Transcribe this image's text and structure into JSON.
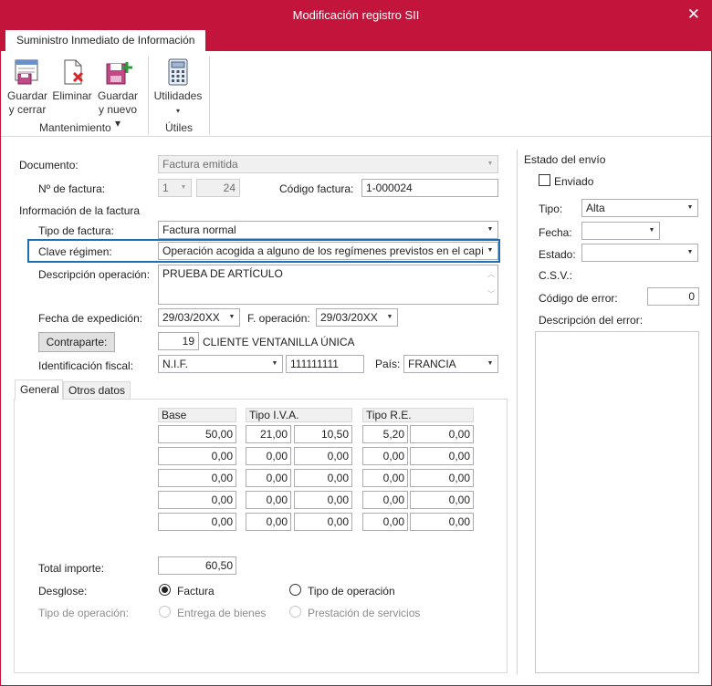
{
  "window": {
    "title": "Modificación registro SII",
    "close_glyph": "✕"
  },
  "ribbon": {
    "tab": "Suministro Inmediato de Información",
    "buttons": {
      "save_close": {
        "line1": "Guardar",
        "line2": "y cerrar",
        "icon": "save-close-icon"
      },
      "delete": {
        "line1": "Eliminar",
        "icon": "delete-icon"
      },
      "save_new": {
        "line1": "Guardar",
        "line2": "y nuevo ▾",
        "icon": "save-new-icon"
      },
      "utilities": {
        "line1": "Utilidades",
        "line2": "▾",
        "icon": "calculator-icon"
      }
    },
    "groups": {
      "maintenance": "Mantenimiento",
      "utils": "Útiles"
    }
  },
  "form": {
    "documento": {
      "label": "Documento:",
      "value": "Factura emitida"
    },
    "n_factura": {
      "label": "Nº de factura:",
      "serie": "1",
      "number": "24"
    },
    "codigo_factura": {
      "label": "Código factura:",
      "value": "1-000024"
    },
    "section_info": "Información de la factura",
    "tipo_factura": {
      "label": "Tipo de factura:",
      "value": "Factura normal"
    },
    "clave_regimen": {
      "label": "Clave régimen:",
      "value": "Operación acogida a alguno de los regímenes previstos en el capítu"
    },
    "descripcion": {
      "label": "Descripción operación:",
      "value": "PRUEBA DE ARTÍCULO"
    },
    "fecha_expedicion": {
      "label": "Fecha de expedición:",
      "value": "29/03/20XX"
    },
    "f_operacion": {
      "label": "F. operación:",
      "value": "29/03/20XX"
    },
    "contraparte": {
      "button": "Contraparte:",
      "code": "19",
      "name": "CLIENTE VENTANILLA ÚNICA"
    },
    "identificacion": {
      "label": "Identificación fiscal:",
      "type": "N.I.F.",
      "value": "111111111"
    },
    "pais": {
      "label": "País:",
      "value": "FRANCIA"
    }
  },
  "tabs": [
    {
      "label": "General"
    },
    {
      "label": "Otros datos"
    }
  ],
  "grid": {
    "headers": {
      "base": "Base",
      "iva": "Tipo I.V.A.",
      "re": "Tipo R.E."
    },
    "rows": [
      {
        "base": "50,00",
        "iva_pct": "21,00",
        "iva_amt": "10,50",
        "re_pct": "5,20",
        "re_amt": "0,00"
      },
      {
        "base": "0,00",
        "iva_pct": "0,00",
        "iva_amt": "0,00",
        "re_pct": "0,00",
        "re_amt": "0,00"
      },
      {
        "base": "0,00",
        "iva_pct": "0,00",
        "iva_amt": "0,00",
        "re_pct": "0,00",
        "re_amt": "0,00"
      },
      {
        "base": "0,00",
        "iva_pct": "0,00",
        "iva_amt": "0,00",
        "re_pct": "0,00",
        "re_amt": "0,00"
      },
      {
        "base": "0,00",
        "iva_pct": "0,00",
        "iva_amt": "0,00",
        "re_pct": "0,00",
        "re_amt": "0,00"
      }
    ],
    "total": {
      "label": "Total importe:",
      "value": "60,50"
    }
  },
  "desglose": {
    "label": "Desglose:",
    "opt1": "Factura",
    "opt2": "Tipo de operación",
    "selected": "Factura"
  },
  "tipo_operacion": {
    "label": "Tipo de operación:",
    "opt1": "Entrega de bienes",
    "opt2": "Prestación de servicios"
  },
  "estado_envio": {
    "title": "Estado del envío",
    "enviado": {
      "label": "Enviado",
      "checked": false
    },
    "tipo": {
      "label": "Tipo:",
      "value": "Alta"
    },
    "fecha": {
      "label": "Fecha:",
      "value": ""
    },
    "estado": {
      "label": "Estado:",
      "value": ""
    },
    "csv": {
      "label": "C.S.V.:"
    },
    "codigo_error": {
      "label": "Código de error:",
      "value": "0"
    },
    "descripcion_error": {
      "label": "Descripción del error:",
      "value": ""
    }
  },
  "colors": {
    "accent": "#c3143c",
    "focus": "#1f6fb4"
  }
}
